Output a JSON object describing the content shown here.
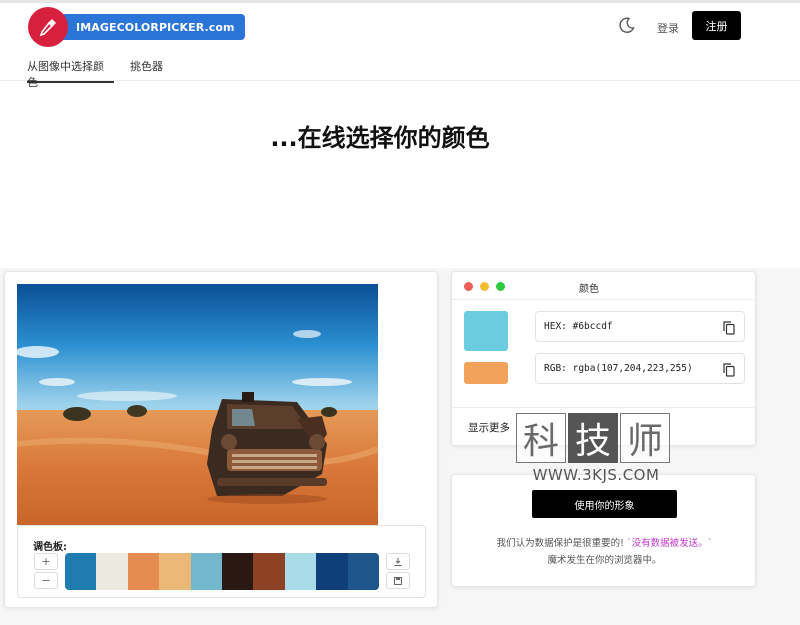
{
  "header": {
    "logo_text": "IMAGECOLORPICKER.com",
    "login_label": "登录",
    "signup_label": "注册",
    "tabs": [
      {
        "label": "从图像中选择颜色",
        "active": true
      },
      {
        "label": "挑色器",
        "active": false
      }
    ]
  },
  "hero": {
    "title": "...在线选择你的颜色"
  },
  "palette": {
    "label": "调色板:",
    "add_label": "+",
    "remove_label": "−",
    "colors": [
      "#1f7cb0",
      "#ece9e0",
      "#e58c50",
      "#ecb878",
      "#72b7cc",
      "#2a1812",
      "#8d4226",
      "#aadbe8",
      "#0f3f78",
      "#1e558a"
    ]
  },
  "color_panel": {
    "title": "颜色",
    "hex_value": "HEX: #6bccdf",
    "rgb_value": "RGB: rgba(107,204,223,255)",
    "primary_color": "#6bccdf",
    "secondary_color": "#f2a35b",
    "more_label": "显示更多"
  },
  "use_panel": {
    "button_label": "使用你的形象",
    "privacy_prefix": "我们认为数据保护是很重要的!",
    "privacy_highlight": "`没有数据被发送。`",
    "privacy_line2": "魔术发生在你的浏览器中。"
  },
  "watermark": {
    "chars": [
      "科",
      "技",
      "师"
    ],
    "url": "WWW.3KJS.COM"
  }
}
